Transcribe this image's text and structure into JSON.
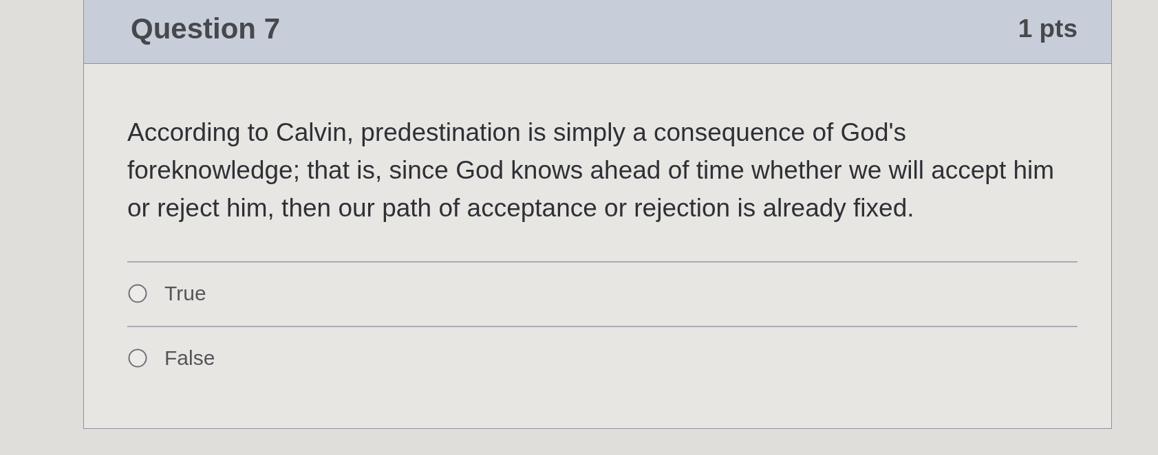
{
  "question": {
    "title": "Question 7",
    "points": "1 pts",
    "text": "According to Calvin, predestination is simply a consequence of God's foreknowledge; that is, since God knows ahead of time whether we will accept him or reject him, then our path of acceptance or rejection is already fixed."
  },
  "answers": [
    {
      "label": "True",
      "selected": false
    },
    {
      "label": "False",
      "selected": false
    }
  ]
}
